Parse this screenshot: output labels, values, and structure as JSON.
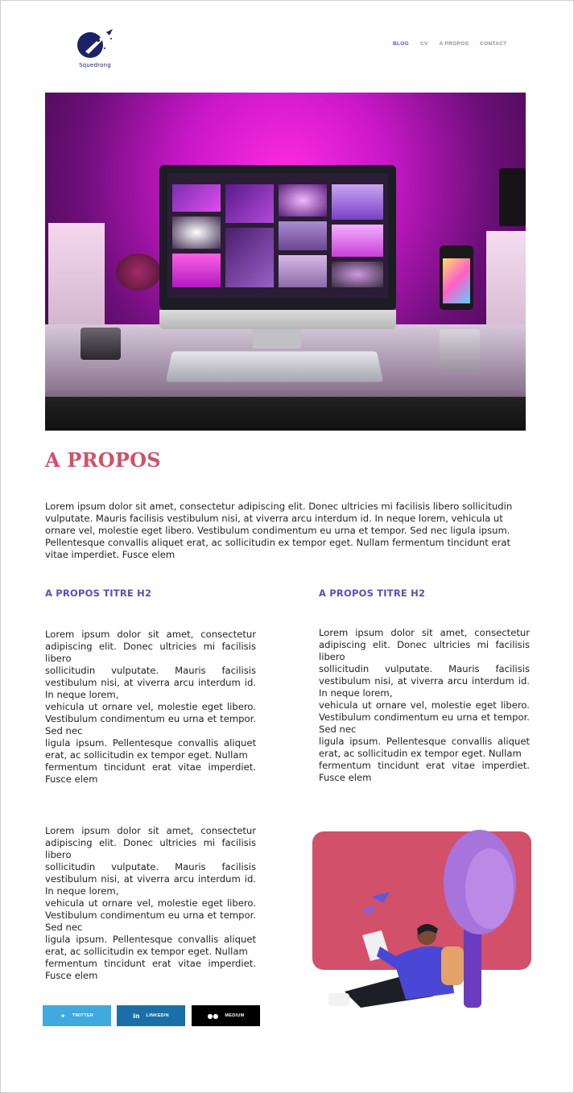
{
  "header": {
    "logo_text": "Squedrong",
    "nav": [
      {
        "label": "BLOG",
        "active": true
      },
      {
        "label": "CV",
        "active": false
      },
      {
        "label": "A PROPOS",
        "active": false
      },
      {
        "label": "CONTACT",
        "active": false
      }
    ]
  },
  "page": {
    "title": "A PROPOS",
    "intro": "Lorem ipsum dolor sit amet, consectetur adipiscing elit. Donec ultricies mi facilisis libero sollicitudin vulputate. Mauris facilisis vestibulum nisi, at viverra arcu interdum id. In neque lorem, vehicula ut ornare vel, molestie eget libero. Vestibulum condimentum eu urna et tempor. Sed nec ligula ipsum. Pellentesque convallis aliquet erat, ac sollicitudin ex tempor eget. Nullam fermentum tincidunt erat vitae imperdiet. Fusce elem"
  },
  "sections": [
    {
      "heading": "A PROPOS TITRE H2",
      "lines": [
        "Lorem ipsum dolor sit amet, consectetur adipiscing elit. Donec ultricies mi facilisis libero",
        "sollicitudin vulputate. Mauris facilisis vestibulum nisi, at viverra arcu interdum id. In neque lorem,",
        "vehicula ut ornare vel, molestie eget libero. Vestibulum condimentum eu urna et tempor. Sed nec",
        "ligula ipsum. Pellentesque convallis aliquet erat, ac sollicitudin ex tempor eget. Nullam",
        "fermentum tincidunt erat vitae imperdiet. Fusce elem"
      ]
    },
    {
      "heading": "A PROPOS TITRE H2",
      "lines": [
        "Lorem ipsum dolor sit amet, consectetur adipiscing elit. Donec ultricies mi facilisis libero",
        "sollicitudin vulputate. Mauris facilisis vestibulum nisi, at viverra arcu interdum id. In neque lorem,",
        "vehicula ut ornare vel, molestie eget libero. Vestibulum condimentum eu urna et tempor. Sed nec",
        "ligula ipsum. Pellentesque convallis aliquet erat, ac sollicitudin ex tempor eget. Nullam",
        "fermentum tincidunt erat vitae imperdiet. Fusce elem"
      ]
    },
    {
      "lines": [
        "Lorem ipsum dolor sit amet, consectetur adipiscing elit. Donec ultricies mi facilisis libero",
        "sollicitudin vulputate. Mauris facilisis vestibulum nisi, at viverra arcu interdum id. In neque lorem,",
        "vehicula ut ornare vel, molestie eget libero. Vestibulum condimentum eu urna et tempor. Sed nec",
        "ligula ipsum. Pellentesque convallis aliquet erat, ac sollicitudin ex tempor eget. Nullam",
        "fermentum tincidunt erat vitae imperdiet. Fusce elem"
      ]
    }
  ],
  "share": [
    {
      "label": "TWITTER",
      "icon": "twitter-icon",
      "color": "#3fa9e0"
    },
    {
      "label": "LINKEDIN",
      "icon": "linkedin-icon",
      "color": "#1a6fa8"
    },
    {
      "label": "MEDIUM",
      "icon": "medium-icon",
      "color": "#000000"
    }
  ],
  "colors": {
    "accent": "#d2506a",
    "heading2": "#5a4fb3",
    "nav_active": "#5a4fb3",
    "logo": "#1b2366"
  }
}
